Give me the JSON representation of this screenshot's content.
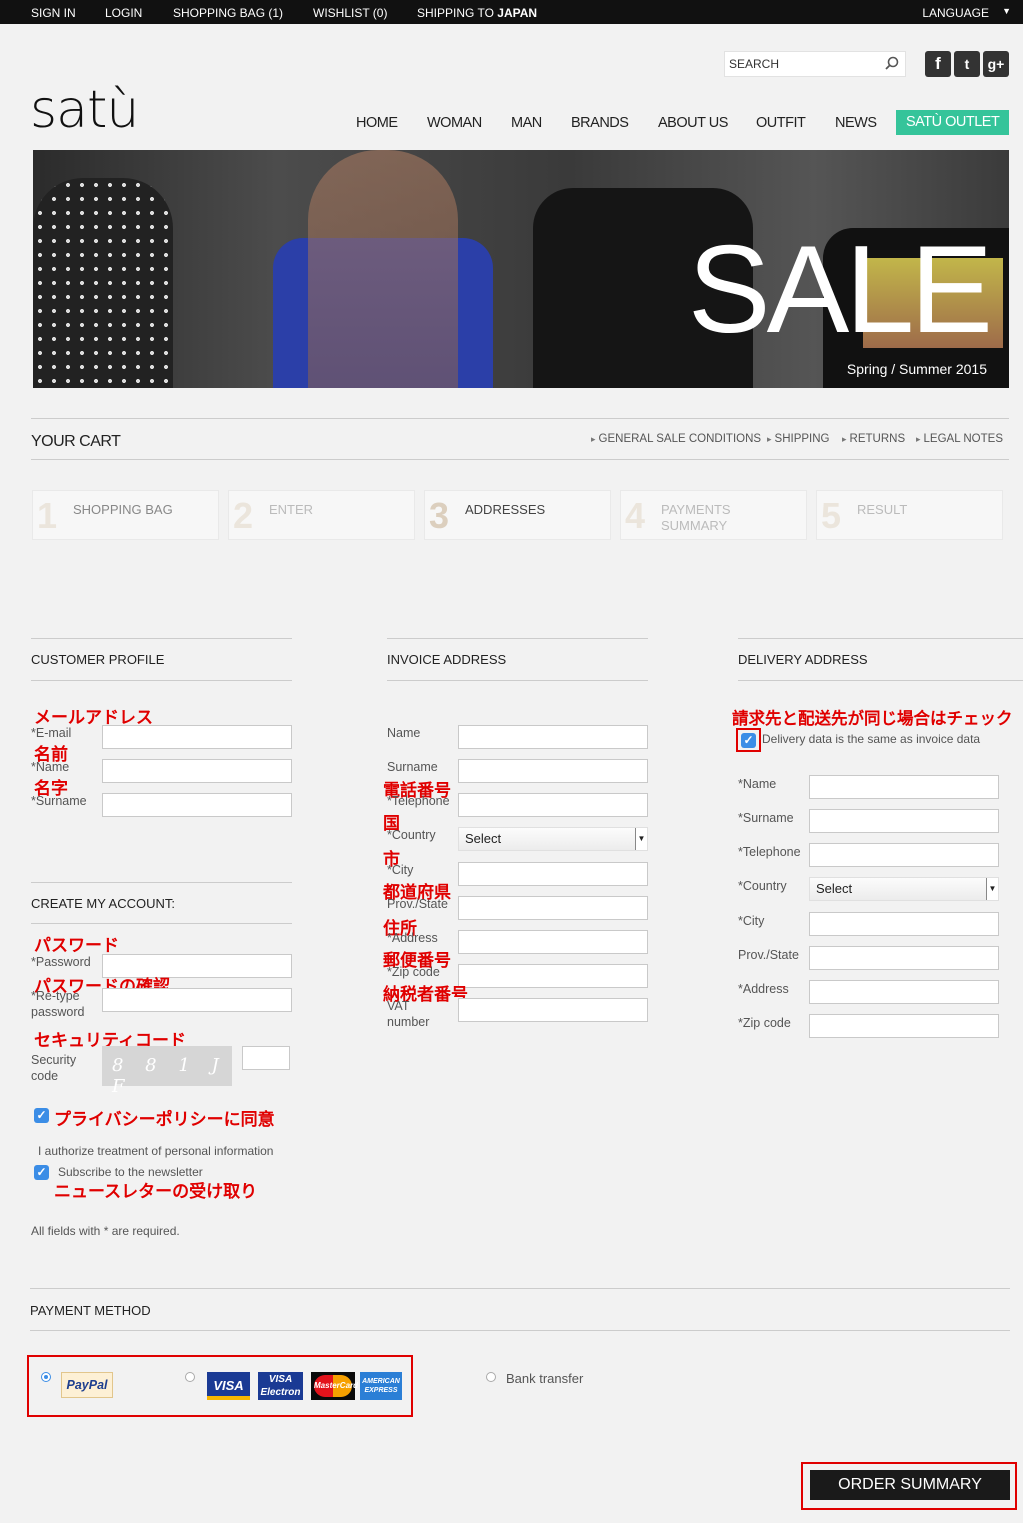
{
  "topbar": {
    "sign_in": "SIGN IN",
    "login": "LOGIN",
    "shopping_bag": "SHOPPING BAG (1)",
    "wishlist": "WISHLIST (0)",
    "shipping_prefix": "SHIPPING TO",
    "shipping_country": "JAPAN",
    "language": "LANGUAGE"
  },
  "header": {
    "logo": "satù",
    "search_placeholder": "SEARCH",
    "social": [
      "f",
      "t",
      "g+"
    ]
  },
  "nav": {
    "items": [
      "HOME",
      "WOMAN",
      "MAN",
      "BRANDS",
      "ABOUT US",
      "OUTFIT",
      "NEWS"
    ],
    "outlet": "SATÙ OUTLET",
    "outlet_color": "#35c49a"
  },
  "banner": {
    "title": "SALE",
    "subtitle": "Spring / Summer 2015"
  },
  "cart": {
    "title": "YOUR CART",
    "links": [
      "GENERAL SALE CONDITIONS",
      "SHIPPING",
      "RETURNS",
      "LEGAL NOTES"
    ],
    "steps": [
      {
        "num": "1",
        "label": "SHOPPING BAG"
      },
      {
        "num": "2",
        "label": "ENTER"
      },
      {
        "num": "3",
        "label": "ADDRESSES",
        "active": true
      },
      {
        "num": "4",
        "label": "PAYMENTS SUMMARY"
      },
      {
        "num": "5",
        "label": "RESULT"
      }
    ]
  },
  "customer_profile": {
    "title": "CUSTOMER PROFILE",
    "email_label": "*E-mail",
    "name_label": "*Name",
    "surname_label": "*Surname"
  },
  "create_account": {
    "title": "CREATE MY ACCOUNT:",
    "password_label": "*Password",
    "retype_label_1": "*Re-type",
    "retype_label_2": "password",
    "security_label_1": "Security",
    "security_label_2": "code",
    "captcha_text": "8 8 1 J F",
    "privacy_text": "I authorize treatment of personal information",
    "newsletter_text": "Subscribe to the newsletter",
    "required_note": "All fields with * are required."
  },
  "invoice": {
    "title": "INVOICE ADDRESS",
    "name": "Name",
    "surname": "Surname",
    "telephone": "*Telephone",
    "country": "*Country",
    "country_value": "Select",
    "city": "*City",
    "prov": "Prov./State",
    "address": "*Address",
    "zip": "*Zip code",
    "vat_1": "VAT",
    "vat_2": "number"
  },
  "delivery": {
    "title": "DELIVERY ADDRESS",
    "same_text": "Delivery data is the same as invoice data",
    "name": "*Name",
    "surname": "*Surname",
    "telephone": "*Telephone",
    "country": "*Country",
    "country_value": "Select",
    "city": "*City",
    "prov": "Prov./State",
    "address": "*Address",
    "zip": "*Zip code"
  },
  "annotations": {
    "email": "メールアドレス",
    "name": "名前",
    "surname": "名字",
    "password": "パスワード",
    "password_confirm": "パスワードの確認",
    "security": "セキュリティコード",
    "privacy": "プライバシーポリシーに同意",
    "newsletter": "ニュースレターの受け取り",
    "telephone": "電話番号",
    "country": "国",
    "city": "市",
    "prefecture": "都道府県",
    "address": "住所",
    "zip": "郵便番号",
    "vat": "納税者番号",
    "same_address": "請求先と配送先が同じ場合はチェック",
    "color": "#e00000"
  },
  "payment": {
    "title": "PAYMENT METHOD",
    "paypal": "PayPal",
    "cards": [
      "VISA",
      "VISA Electron",
      "MasterCard",
      "AMERICAN EXPRESS"
    ],
    "bank": "Bank transfer"
  },
  "order_button": "ORDER SUMMARY"
}
